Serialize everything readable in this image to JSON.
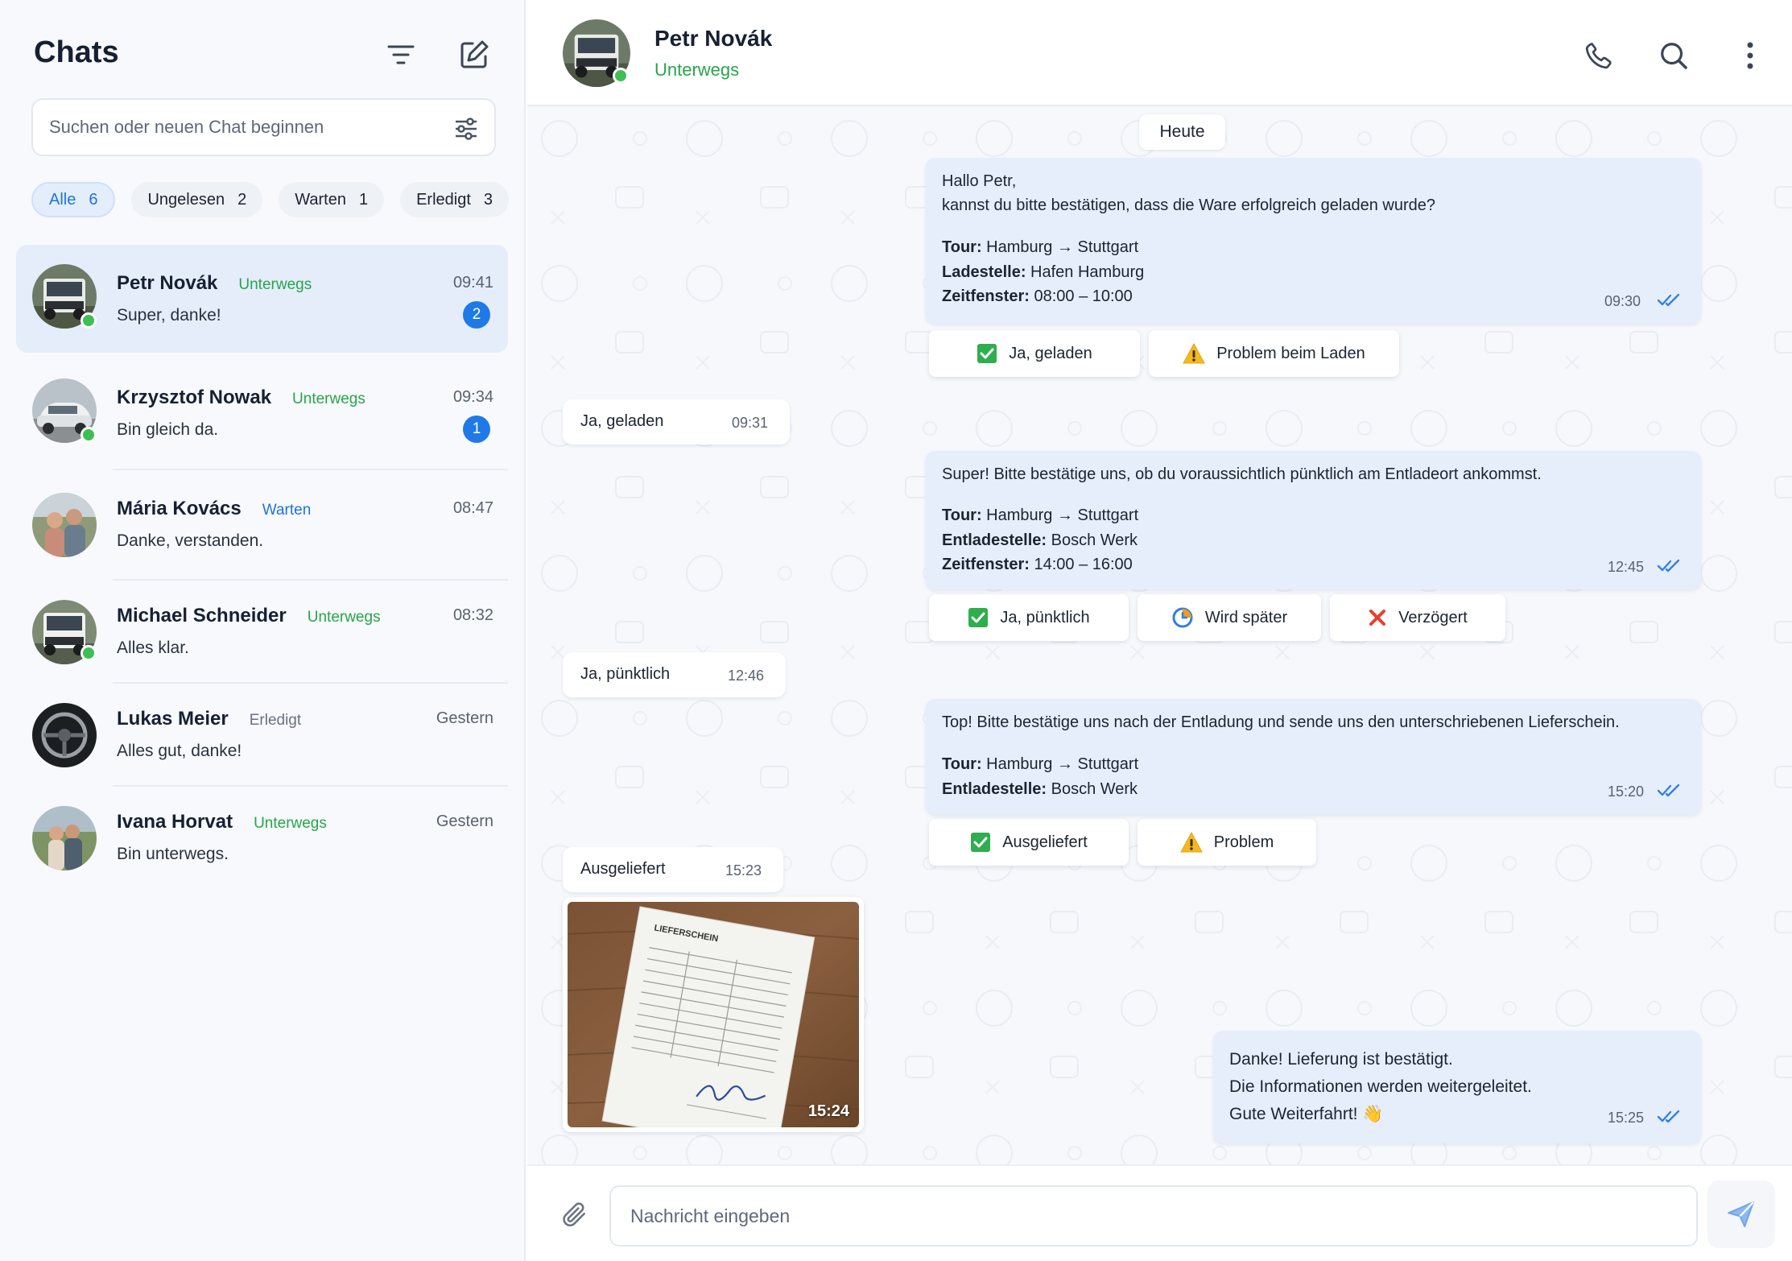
{
  "sidebar": {
    "title": "Chats",
    "search_placeholder": "Suchen oder neuen Chat beginnen",
    "filters": [
      {
        "label": "Alle",
        "count": "6"
      },
      {
        "label": "Ungelesen",
        "count": "2"
      },
      {
        "label": "Warten",
        "count": "1"
      },
      {
        "label": "Erledigt",
        "count": "3"
      }
    ],
    "chats": [
      {
        "name": "Petr Novák",
        "status": "Unterwegs",
        "time": "09:41",
        "message": "Super, danke!",
        "unread": "2"
      },
      {
        "name": "Krzysztof Nowak",
        "status": "Unterwegs",
        "time": "09:34",
        "message": "Bin gleich da.",
        "unread": "1"
      },
      {
        "name": "Mária Kovács",
        "status": "Warten",
        "time": "08:47",
        "message": "Danke, verstanden."
      },
      {
        "name": "Michael Schneider",
        "status": "Unterwegs",
        "time": "08:32",
        "message": "Alles klar."
      },
      {
        "name": "Lukas Meier",
        "status": "Erledigt",
        "time": "Gestern",
        "message": "Alles gut, danke!"
      },
      {
        "name": "Ivana Horvat",
        "status": "Unterwegs",
        "time": "Gestern",
        "message": "Bin unterwegs."
      }
    ]
  },
  "header": {
    "name": "Petr Novák",
    "status": "Unterwegs"
  },
  "conversation": {
    "day_label": "Heute",
    "m1": {
      "line1": "Hallo Petr,",
      "line2": "kannst du bitte bestätigen, dass die Ware erfolgreich geladen wurde?",
      "tour_label": "Tour:",
      "tour_value": "Hamburg → Stuttgart",
      "place_label": "Ladestelle:",
      "place_value": "Hafen Hamburg",
      "window_label": "Zeitfenster:",
      "window_value": "08:00 – 10:00",
      "time": "09:30",
      "actions": [
        "Ja, geladen",
        "Problem beim Laden"
      ]
    },
    "r1": {
      "text": "Ja, geladen",
      "time": "09:31"
    },
    "m2": {
      "line1": "Super! Bitte bestätige uns, ob du voraussichtlich pünktlich am Entladeort ankommst.",
      "tour_label": "Tour:",
      "tour_value": "Hamburg → Stuttgart",
      "place_label": "Entladestelle:",
      "place_value": "Bosch Werk",
      "window_label": "Zeitfenster:",
      "window_value": "14:00 – 16:00",
      "time": "12:45",
      "actions": [
        "Ja, pünktlich",
        "Wird später",
        "Verzögert"
      ]
    },
    "r2": {
      "text": "Ja, pünktlich",
      "time": "12:46"
    },
    "m3": {
      "line1": "Top! Bitte bestätige uns nach der Entladung und sende uns den unterschriebenen Lieferschein.",
      "tour_label": "Tour:",
      "tour_value": "Hamburg → Stuttgart",
      "place_label": "Entladestelle:",
      "place_value": "Bosch Werk",
      "time": "15:20",
      "actions": [
        "Ausgeliefert",
        "Problem"
      ]
    },
    "r3": {
      "text": "Ausgeliefert",
      "time": "15:23"
    },
    "photo": {
      "doc_title": "LIEFERSCHEIN",
      "time": "15:24"
    },
    "m4": {
      "line1": "Danke! Lieferung ist bestätigt.",
      "line2": "Die Informationen werden weitergeleitet.",
      "line3": "Gute Weiterfahrt! 👋",
      "time": "15:25"
    }
  },
  "composer": {
    "placeholder": "Nachricht eingeben"
  },
  "colors": {
    "accent": "#1f7ae8",
    "online": "#3dbf54",
    "status_green": "#27a64a",
    "outgoing_bubble": "#e6eefb"
  }
}
